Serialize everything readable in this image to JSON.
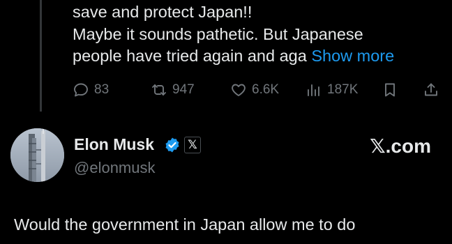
{
  "parent_tweet": {
    "lines": [
      "save and protect Japan!!",
      "Maybe it sounds pathetic. But Japanese",
      "people have tried again and aga"
    ],
    "show_more": "Show more",
    "stats": {
      "replies": "83",
      "reposts": "947",
      "likes": "6.6K",
      "views": "187K"
    }
  },
  "quoted_tweet": {
    "author_name": "Elon Musk",
    "affiliation_badge": "𝕏",
    "handle": "@elonmusk",
    "brand_link": "𝕏.com",
    "text": "Would the government in Japan allow me to do"
  },
  "colors": {
    "background": "#000000",
    "text": "#e7e9ea",
    "muted": "#71767b",
    "accent": "#1d9bf0"
  }
}
